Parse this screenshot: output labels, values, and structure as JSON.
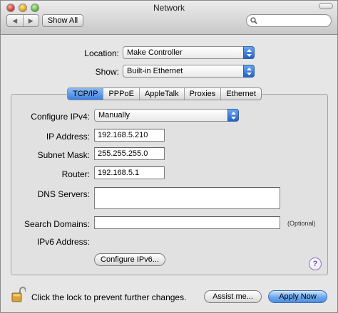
{
  "window": {
    "title": "Network"
  },
  "toolbar": {
    "back_glyph": "◀",
    "forward_glyph": "▶",
    "show_all_label": "Show All",
    "search": {
      "placeholder": "",
      "value": ""
    }
  },
  "location": {
    "label": "Location:",
    "value": "Make Controller"
  },
  "show": {
    "label": "Show:",
    "value": "Built-in Ethernet"
  },
  "tabs": [
    {
      "label": "TCP/IP",
      "active": true
    },
    {
      "label": "PPPoE",
      "active": false
    },
    {
      "label": "AppleTalk",
      "active": false
    },
    {
      "label": "Proxies",
      "active": false
    },
    {
      "label": "Ethernet",
      "active": false
    }
  ],
  "tcpip": {
    "configure_ipv4": {
      "label": "Configure IPv4:",
      "value": "Manually"
    },
    "ip_address": {
      "label": "IP Address:",
      "value": "192.168.5.210"
    },
    "subnet_mask": {
      "label": "Subnet Mask:",
      "value": "255.255.255.0"
    },
    "router": {
      "label": "Router:",
      "value": "192.168.5.1"
    },
    "dns_servers": {
      "label": "DNS Servers:",
      "value": ""
    },
    "search_domains": {
      "label": "Search Domains:",
      "value": "",
      "hint": "(Optional)"
    },
    "ipv6_address": {
      "label": "IPv6 Address:"
    },
    "configure_ipv6_label": "Configure IPv6...",
    "help_label": "?"
  },
  "footer": {
    "lock_text": "Click the lock to prevent further changes.",
    "assist_label": "Assist me...",
    "apply_label": "Apply Now"
  },
  "colors": {
    "accent": "#3c7fe0",
    "window_bg": "#e6e6e6",
    "panel_bg": "#e1e1e1"
  },
  "icons": {
    "search": "search-icon",
    "lock": "lock-open-icon",
    "help": "help-icon"
  }
}
